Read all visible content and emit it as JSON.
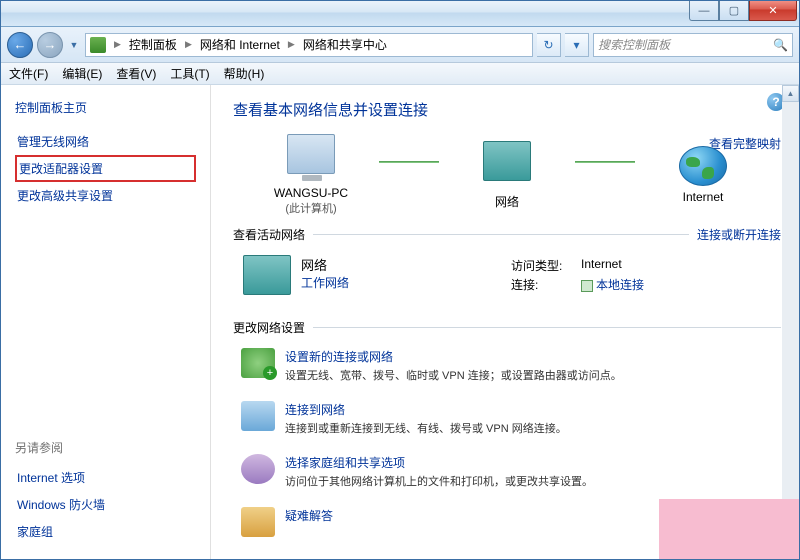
{
  "titlebar": {
    "min": "—",
    "max": "▢",
    "close": "✕"
  },
  "nav": {
    "back": "←",
    "fwd": "→",
    "drop": "▼",
    "refresh": "↻",
    "crumb1": "控制面板",
    "crumb2": "网络和 Internet",
    "crumb3": "网络和共享中心",
    "search_placeholder": "搜索控制面板"
  },
  "menu": {
    "file": "文件(F)",
    "edit": "编辑(E)",
    "view": "查看(V)",
    "tools": "工具(T)",
    "help": "帮助(H)"
  },
  "sidebar": {
    "home": "控制面板主页",
    "items": [
      "管理无线网络",
      "更改适配器设置",
      "更改高级共享设置"
    ],
    "see_also": "另请参阅",
    "extra": [
      "Internet 选项",
      "Windows 防火墙",
      "家庭组"
    ]
  },
  "main": {
    "heading": "查看基本网络信息并设置连接",
    "map_link": "查看完整映射",
    "nodes": {
      "pc": "WANGSU-PC",
      "pc_sub": "(此计算机)",
      "net": "网络",
      "inet": "Internet"
    },
    "active_title": "查看活动网络",
    "active_link": "连接或断开连接",
    "active": {
      "name": "网络",
      "type": "工作网络",
      "access_k": "访问类型:",
      "access_v": "Internet",
      "conn_k": "连接:",
      "conn_v": "本地连接"
    },
    "change_title": "更改网络设置",
    "tasks": [
      {
        "t": "设置新的连接或网络",
        "d": "设置无线、宽带、拨号、临时或 VPN 连接；或设置路由器或访问点。"
      },
      {
        "t": "连接到网络",
        "d": "连接到或重新连接到无线、有线、拨号或 VPN 网络连接。"
      },
      {
        "t": "选择家庭组和共享选项",
        "d": "访问位于其他网络计算机上的文件和打印机，或更改共享设置。"
      },
      {
        "t": "疑难解答",
        "d": ""
      }
    ]
  }
}
